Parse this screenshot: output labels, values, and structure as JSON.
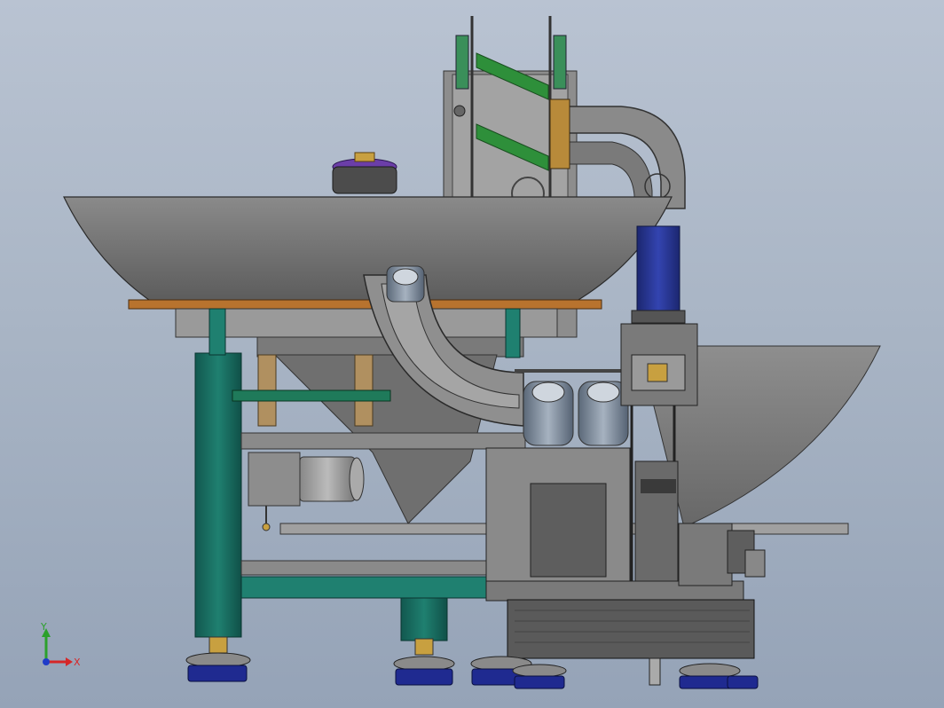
{
  "viewport": {
    "background_top": "#b9c3d2",
    "background_bottom": "#95a3b7"
  },
  "model": {
    "description_kind": "bottle unscrambler machine (CAD front view)",
    "frame_color": "#1e7a6e",
    "body_color": "#6f6f6f",
    "plate_color": "#b8732e",
    "motor_color": "#2a3a9a",
    "accent_green": "#2e8f3a"
  },
  "triad": {
    "y_label": "Y",
    "x_label": "X",
    "y_color": "#2ca02c",
    "x_color": "#d62728",
    "z_color": "#1f3cc9"
  }
}
